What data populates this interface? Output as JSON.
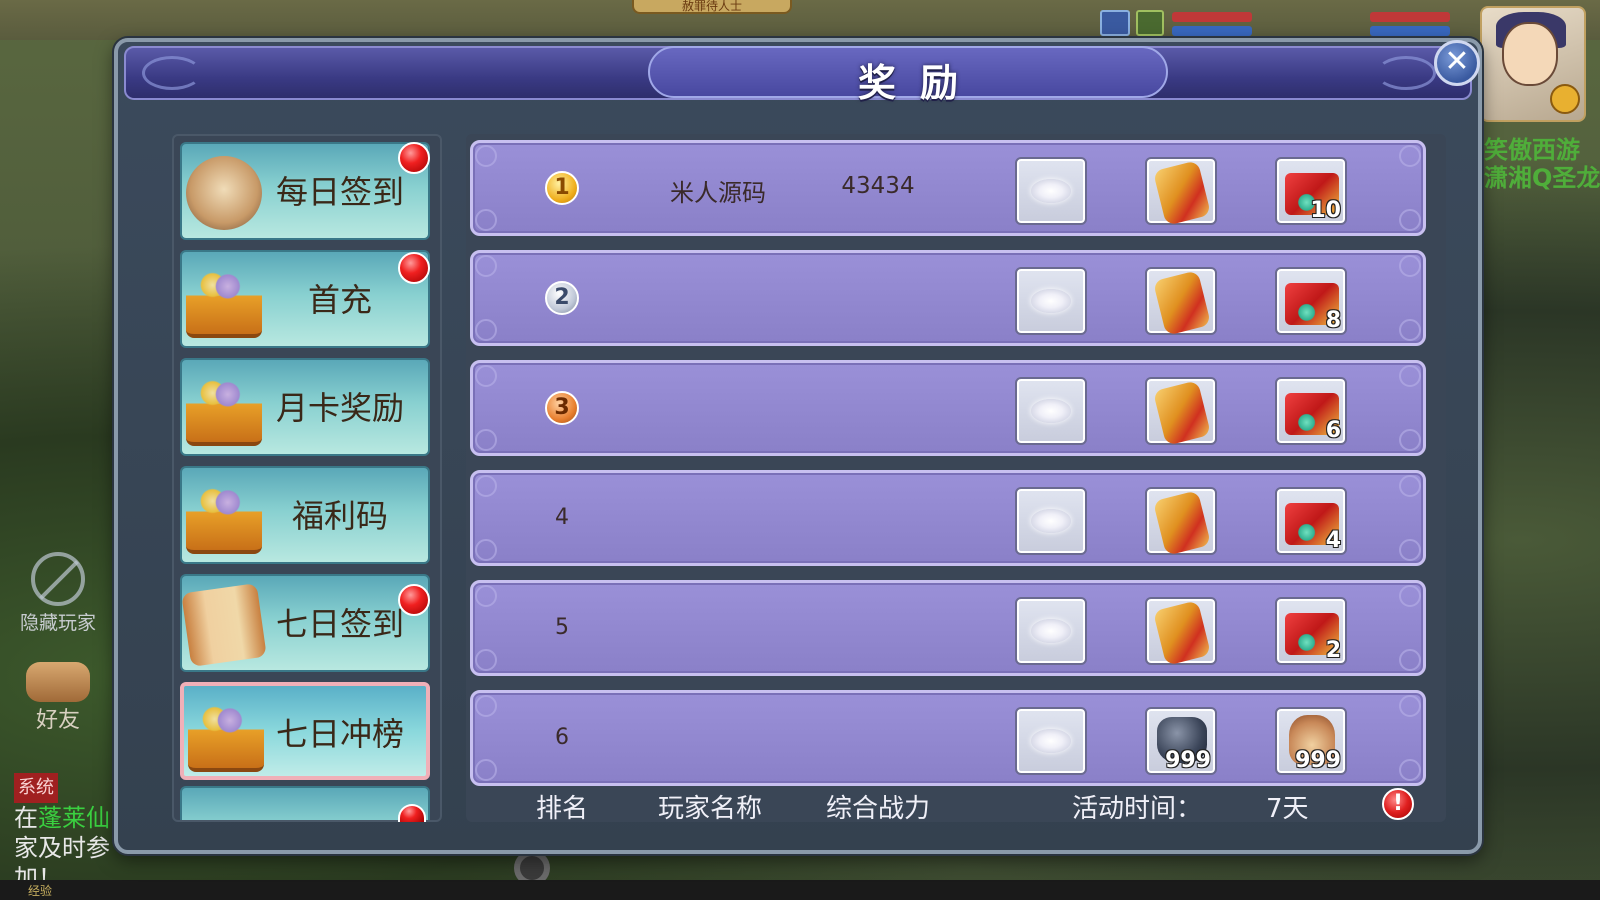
{
  "background": {
    "title_plate": "赦罪待人士",
    "right_name_line1": "笑傲西游",
    "right_name_line2": "潇湘Q圣龙",
    "hide_players_label": "隐藏玩家",
    "friends_label": "好友",
    "chat_system_tag": "系统",
    "chat_line1_green": "蓬莱仙",
    "chat_line1_prefix": "在",
    "chat_line2": "家及时参加！",
    "exp_label": "经验"
  },
  "dialog": {
    "title": "奖励",
    "close_label": "✕"
  },
  "sidebar": {
    "items": [
      {
        "label": "每日签到",
        "icon": "scroll-icon",
        "has_red_dot": true
      },
      {
        "label": "首充",
        "icon": "treasure-chest-icon",
        "has_red_dot": true
      },
      {
        "label": "月卡奖励",
        "icon": "treasure-chest-icon",
        "has_red_dot": false
      },
      {
        "label": "福利码",
        "icon": "treasure-chest-icon",
        "has_red_dot": false
      },
      {
        "label": "七日签到",
        "icon": "parchment-icon",
        "has_red_dot": true
      },
      {
        "label": "七日冲榜",
        "icon": "treasure-chest-icon",
        "has_red_dot": false,
        "selected": true
      }
    ]
  },
  "ranking": {
    "rows": [
      {
        "rank": "1",
        "medal": "gold",
        "player": "米人源码",
        "power": "43434",
        "rewards": [
          {
            "icon": "cloud-icon",
            "qty": ""
          },
          {
            "icon": "gold-scroll-icon",
            "qty": ""
          },
          {
            "icon": "gem-box-icon",
            "qty": "10"
          }
        ]
      },
      {
        "rank": "2",
        "medal": "silver",
        "player": "",
        "power": "",
        "rewards": [
          {
            "icon": "cloud-icon",
            "qty": ""
          },
          {
            "icon": "gold-scroll-icon",
            "qty": ""
          },
          {
            "icon": "gem-box-icon",
            "qty": "8"
          }
        ]
      },
      {
        "rank": "3",
        "medal": "bronze",
        "player": "",
        "power": "",
        "rewards": [
          {
            "icon": "cloud-icon",
            "qty": ""
          },
          {
            "icon": "gold-scroll-icon",
            "qty": ""
          },
          {
            "icon": "gem-box-icon",
            "qty": "6"
          }
        ]
      },
      {
        "rank": "4",
        "medal": "",
        "player": "",
        "power": "",
        "rewards": [
          {
            "icon": "cloud-icon",
            "qty": ""
          },
          {
            "icon": "gold-scroll-icon",
            "qty": ""
          },
          {
            "icon": "gem-box-icon",
            "qty": "4"
          }
        ]
      },
      {
        "rank": "5",
        "medal": "",
        "player": "",
        "power": "",
        "rewards": [
          {
            "icon": "cloud-icon",
            "qty": ""
          },
          {
            "icon": "gold-scroll-icon",
            "qty": ""
          },
          {
            "icon": "gem-box-icon",
            "qty": "2"
          }
        ]
      },
      {
        "rank": "6",
        "medal": "",
        "player": "",
        "power": "",
        "rewards": [
          {
            "icon": "cloud-icon",
            "qty": ""
          },
          {
            "icon": "stone-icon",
            "qty": "999"
          },
          {
            "icon": "pouch-icon",
            "qty": "999"
          }
        ]
      }
    ],
    "footer": {
      "rank_header": "排名",
      "player_header": "玩家名称",
      "power_header": "综合战力",
      "time_label": "活动时间：",
      "time_value": "7天"
    }
  }
}
